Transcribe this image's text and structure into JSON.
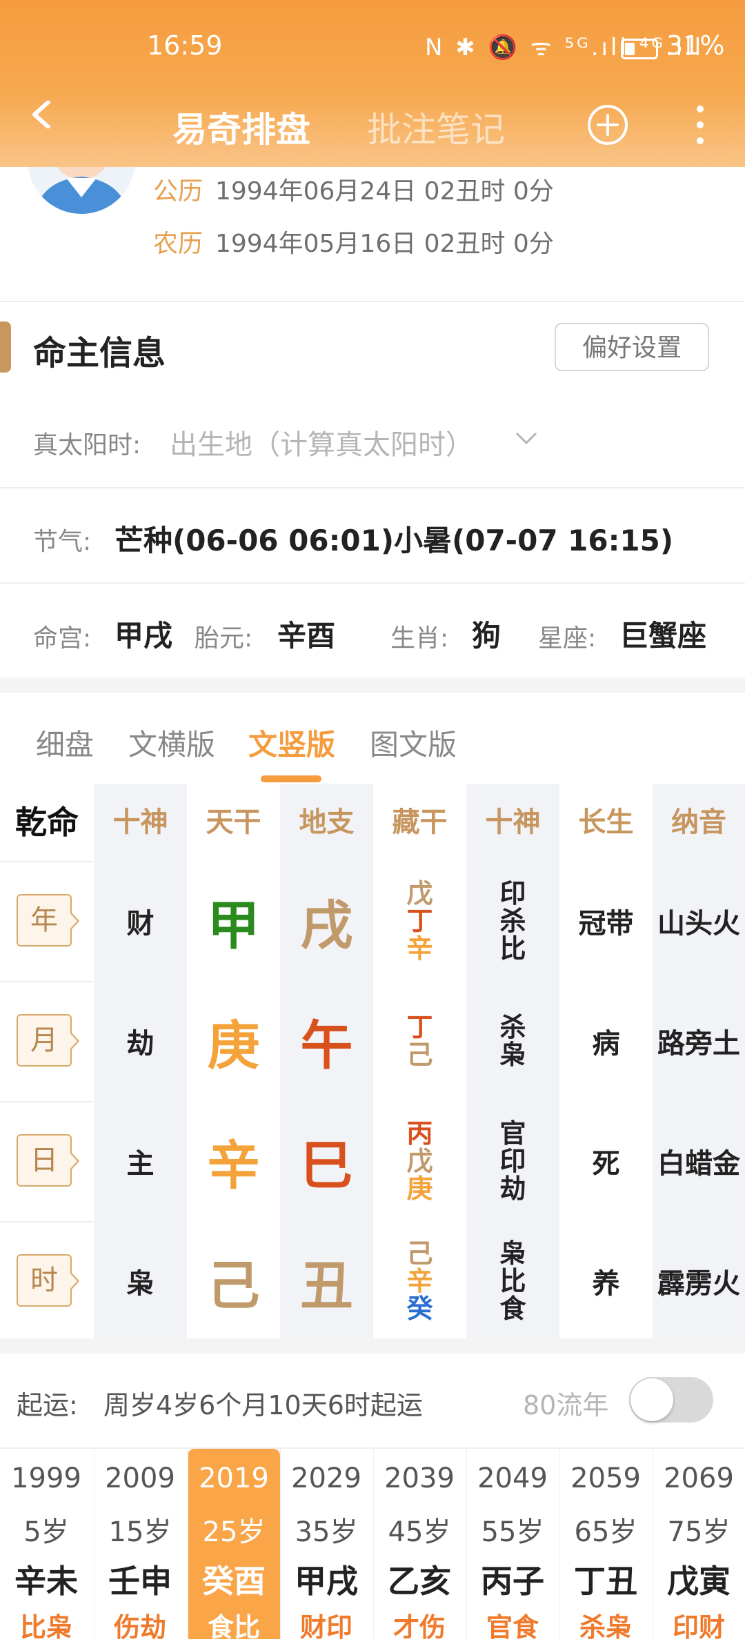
{
  "status": {
    "time": "16:59",
    "icons": "N ✱ 🔕 ᯤ ⁵ᴳ.ıll ⁴ᴳ.ıll",
    "battery": "31%"
  },
  "nav": {
    "title": "易奇排盘",
    "tab2": "批注笔记"
  },
  "birth": {
    "solar_label": "公历",
    "solar_value": "1994年06月24日 02丑时 0分",
    "lunar_label": "农历",
    "lunar_value": "1994年05月16日 02丑时 0分"
  },
  "info": {
    "section_title": "命主信息",
    "pref_button": "偏好设置",
    "solar_time_label": "真太阳时:",
    "solar_time_placeholder": "出生地（计算真太阳时）",
    "jieqi_label": "节气:",
    "jieqi_value": "芒种(06-06 06:01)小暑(07-07 16:15)",
    "minggong_label": "命宫:",
    "minggong_value": "甲戌",
    "taiyuan_label": "胎元:",
    "taiyuan_value": "辛酉",
    "shengxiao_label": "生肖:",
    "shengxiao_value": "狗",
    "xingzuo_label": "星座:",
    "xingzuo_value": "巨蟹座"
  },
  "tabs": [
    "细盘",
    "文横版",
    "文竖版",
    "图文版"
  ],
  "active_tab": "文竖版",
  "table": {
    "corner": "乾命",
    "headers": [
      "十神",
      "天干",
      "地支",
      "藏干",
      "十神",
      "长生",
      "纳音"
    ],
    "rows": [
      {
        "pillar": "年",
        "god": "财",
        "stem": "甲",
        "branch": "戌",
        "hidden": [
          "戊",
          "丁",
          "辛"
        ],
        "hidden_gods": [
          "印",
          "杀",
          "比"
        ],
        "changsheng": "冠带",
        "nayin": "山头火"
      },
      {
        "pillar": "月",
        "god": "劫",
        "stem": "庚",
        "branch": "午",
        "hidden": [
          "丁",
          "己"
        ],
        "hidden_gods": [
          "杀",
          "枭"
        ],
        "changsheng": "病",
        "nayin": "路旁土"
      },
      {
        "pillar": "日",
        "god": "主",
        "stem": "辛",
        "branch": "巳",
        "hidden": [
          "丙",
          "戊",
          "庚"
        ],
        "hidden_gods": [
          "官",
          "印",
          "劫"
        ],
        "changsheng": "死",
        "nayin": "白蜡金"
      },
      {
        "pillar": "时",
        "god": "枭",
        "stem": "己",
        "branch": "丑",
        "hidden": [
          "己",
          "辛",
          "癸"
        ],
        "hidden_gods": [
          "枭",
          "比",
          "食"
        ],
        "changsheng": "养",
        "nayin": "霹雳火"
      }
    ]
  },
  "colors": {
    "wood": "#2a8a1e",
    "fire": "#d8501c",
    "earth": "#c19a6b",
    "metal": "#f3a33a",
    "water": "#2a6fd0",
    "accent": "#f59c3f"
  },
  "luck": {
    "start_label": "起运:",
    "start_text": "周岁4岁6个月10天6时起运",
    "toggle_label": "80流年",
    "toggle_on": false,
    "active_index": 2,
    "columns": [
      {
        "year": "1999",
        "age": "5岁",
        "ganzhi": "辛未",
        "gods": "比枭"
      },
      {
        "year": "2009",
        "age": "15岁",
        "ganzhi": "壬申",
        "gods": "伤劫"
      },
      {
        "year": "2019",
        "age": "25岁",
        "ganzhi": "癸酉",
        "gods": "食比"
      },
      {
        "year": "2029",
        "age": "35岁",
        "ganzhi": "甲戌",
        "gods": "财印"
      },
      {
        "year": "2039",
        "age": "45岁",
        "ganzhi": "乙亥",
        "gods": "才伤"
      },
      {
        "year": "2049",
        "age": "55岁",
        "ganzhi": "丙子",
        "gods": "官食"
      },
      {
        "year": "2059",
        "age": "65岁",
        "ganzhi": "丁丑",
        "gods": "杀枭"
      },
      {
        "year": "2069",
        "age": "75岁",
        "ganzhi": "戊寅",
        "gods": "印财"
      }
    ]
  }
}
